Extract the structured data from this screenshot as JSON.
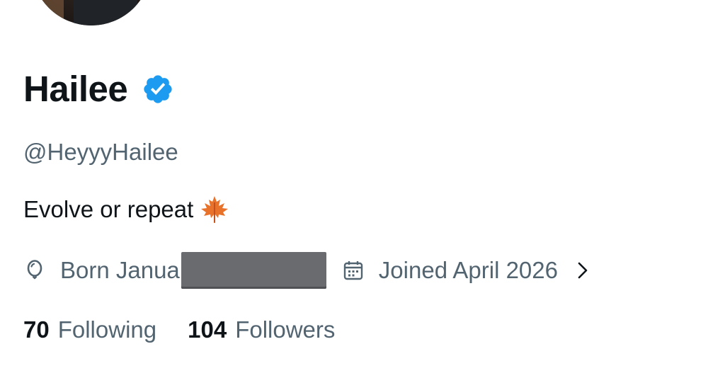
{
  "profile": {
    "display_name": "Hailee",
    "verified_icon": "verified-badge-icon",
    "handle": "@HeyyyHailee",
    "bio": "Evolve or repeat",
    "bio_emoji_icon": "maple-leaf-icon",
    "birthday_text": "Born Janua",
    "birthday_icon": "balloon-icon",
    "birthday_redacted": true,
    "joined_text": "Joined April 2026",
    "joined_icon": "calendar-icon",
    "joined_chevron_icon": "chevron-right-icon"
  },
  "stats": {
    "following_count": "70",
    "following_label": "Following",
    "followers_count": "104",
    "followers_label": "Followers"
  },
  "colors": {
    "primary_text": "#0f1419",
    "secondary_text": "#536471",
    "verified_blue": "#1d9bf0",
    "redaction": "#696b6e",
    "background": "#ffffff"
  }
}
